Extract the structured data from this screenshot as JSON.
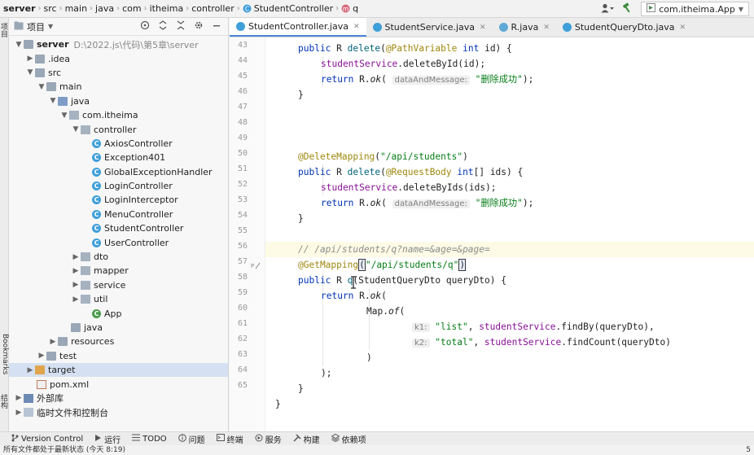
{
  "breadcrumb": {
    "items": [
      "server",
      "src",
      "main",
      "java",
      "com",
      "itheima",
      "controller",
      "StudentController",
      "q"
    ]
  },
  "toolbar": {
    "run_config": "com.itheima.App",
    "user_icon": "person-icon",
    "build_icon": "hammer-icon"
  },
  "left_strip": {
    "project_label": "项目",
    "bookmarks_label": "Bookmarks",
    "structure_label": "结构"
  },
  "project_panel": {
    "title": "项目",
    "root_name": "server",
    "root_path": "D:\\2022.js\\代码\\第5章\\server",
    "items": [
      {
        "label": ".idea"
      },
      {
        "label": "src"
      },
      {
        "label": "main"
      },
      {
        "label": "java"
      },
      {
        "label": "com.itheima"
      },
      {
        "label": "controller"
      },
      {
        "label": "AxiosController"
      },
      {
        "label": "Exception401"
      },
      {
        "label": "GlobalExceptionHandler"
      },
      {
        "label": "LoginController"
      },
      {
        "label": "LoginInterceptor"
      },
      {
        "label": "MenuController"
      },
      {
        "label": "StudentController"
      },
      {
        "label": "UserController"
      },
      {
        "label": "dto"
      },
      {
        "label": "mapper"
      },
      {
        "label": "service"
      },
      {
        "label": "util"
      },
      {
        "label": "App"
      },
      {
        "label": "java"
      },
      {
        "label": "resources"
      },
      {
        "label": "test"
      },
      {
        "label": "target"
      },
      {
        "label": "pom.xml"
      },
      {
        "label": "外部库"
      },
      {
        "label": "临时文件和控制台"
      }
    ]
  },
  "tabs": [
    {
      "label": "StudentController.java"
    },
    {
      "label": "StudentService.java"
    },
    {
      "label": "R.java"
    },
    {
      "label": "StudentQueryDto.java"
    }
  ],
  "editor": {
    "line_numbers": [
      "43",
      "44",
      "45",
      "46",
      "47",
      "48",
      "49",
      "50",
      "51",
      "52",
      "53",
      "54",
      "55",
      "56",
      "57",
      "58",
      "59",
      "60",
      "61",
      "62",
      "63",
      "64",
      "65"
    ],
    "hints": {
      "dataAndMessage": "dataAndMessage:",
      "k1": "k1:",
      "k2": "k2:"
    },
    "strings": {
      "delete_ok": "\"删除成功\"",
      "students_path": "\"/api/students\"",
      "query_path": "\"/api/students/q\"",
      "list_key": "\"list\"",
      "total_key": "\"total\""
    },
    "comment": "// /api/students/q?name=&age=&page="
  },
  "bottom_bar": {
    "items": [
      "Version Control",
      "运行",
      "TODO",
      "问题",
      "终端",
      "服务",
      "构建",
      "依赖项"
    ]
  },
  "status_bar": {
    "message": "所有文件都处于最新状态 (今天 8:19)",
    "right": "5"
  }
}
